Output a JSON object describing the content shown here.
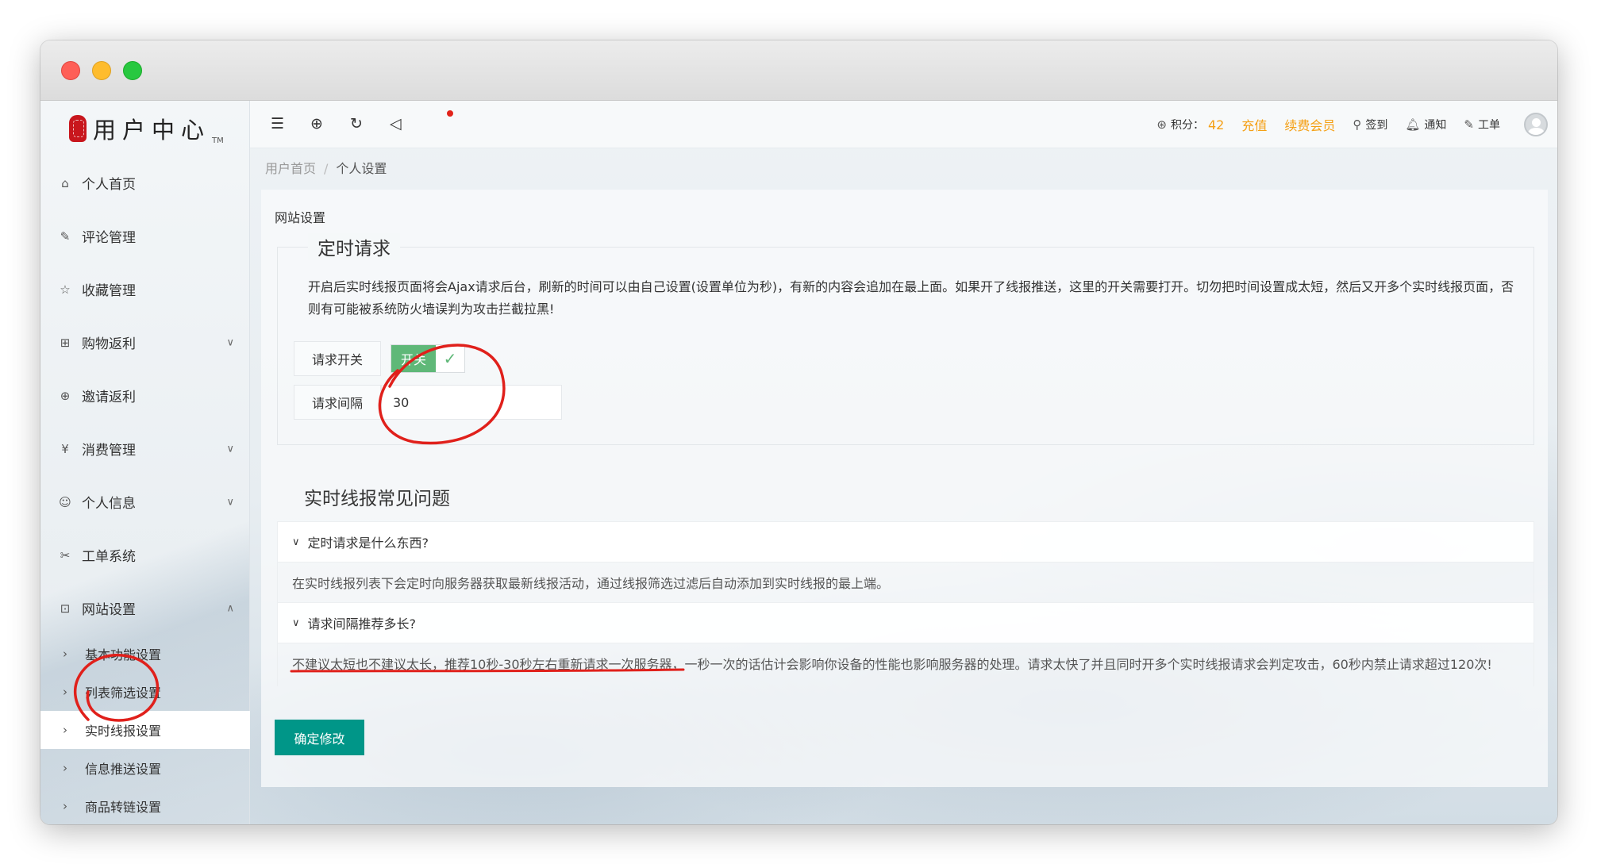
{
  "sidebar": {
    "logo_text": "用户中心",
    "logo_tm": "TM",
    "items": [
      {
        "label": "个人首页",
        "icon": "home-icon"
      },
      {
        "label": "评论管理",
        "icon": "comment-edit-icon"
      },
      {
        "label": "收藏管理",
        "icon": "star-icon"
      },
      {
        "label": "购物返利",
        "icon": "gift-icon"
      },
      {
        "label": "邀请返利",
        "icon": "globe-icon"
      },
      {
        "label": "消费管理",
        "icon": "yen-icon"
      },
      {
        "label": "个人信息",
        "icon": "user-icon"
      },
      {
        "label": "工单系统",
        "icon": "tools-icon"
      },
      {
        "label": "网站设置",
        "icon": "apps-icon"
      }
    ],
    "subitems": [
      {
        "label": "基本功能设置"
      },
      {
        "label": "列表筛选设置"
      },
      {
        "label": "实时线报设置"
      },
      {
        "label": "信息推送设置"
      },
      {
        "label": "商品转链设置"
      }
    ]
  },
  "header": {
    "points_label": "积分：",
    "points_value": "42",
    "recharge": "充值",
    "renew": "续费会员",
    "checkin": "签到",
    "notify": "通知",
    "ticket": "工单"
  },
  "breadcrumb": {
    "home": "用户首页",
    "separator": "/",
    "current": "个人设置"
  },
  "card": {
    "title": "网站设置",
    "section_legend": "定时请求",
    "description": "开启后实时线报页面将会Ajax请求后台，刷新的时间可以由自己设置(设置单位为秒)，有新的内容会追加在最上面。如果开了线报推送，这里的开关需要打开。切勿把时间设置成太短，然后又开多个实时线报页面，否则有可能被系统防火墙误判为攻击拦截拉黑!",
    "switch_label": "请求开关",
    "switch_text": "开关",
    "switch_on": true,
    "interval_label": "请求间隔",
    "interval_value": "30",
    "faq_title": "实时线报常见问题",
    "faq": [
      {
        "question": "定时请求是什么东西?",
        "answer": "在实时线报列表下会定时向服务器获取最新线报活动，通过线报筛选过滤后自动添加到实时线报的最上端。"
      },
      {
        "question": "请求间隔推荐多长?",
        "answer_underlined": "不建议太短也不建议太长，推荐10秒-30秒左右重新请求一次服务器",
        "answer_rest": "，一秒一次的话估计会影响你设备的性能也影响服务器的处理。请求太快了并且同时开多个实时线报请求会判定攻击，60秒内禁止请求超过120次!"
      }
    ],
    "submit": "确定修改"
  },
  "colors": {
    "accent_teal": "#009688",
    "switch_green": "#5fb878",
    "orange": "#f5a015",
    "annotation_red": "#e0201b"
  }
}
